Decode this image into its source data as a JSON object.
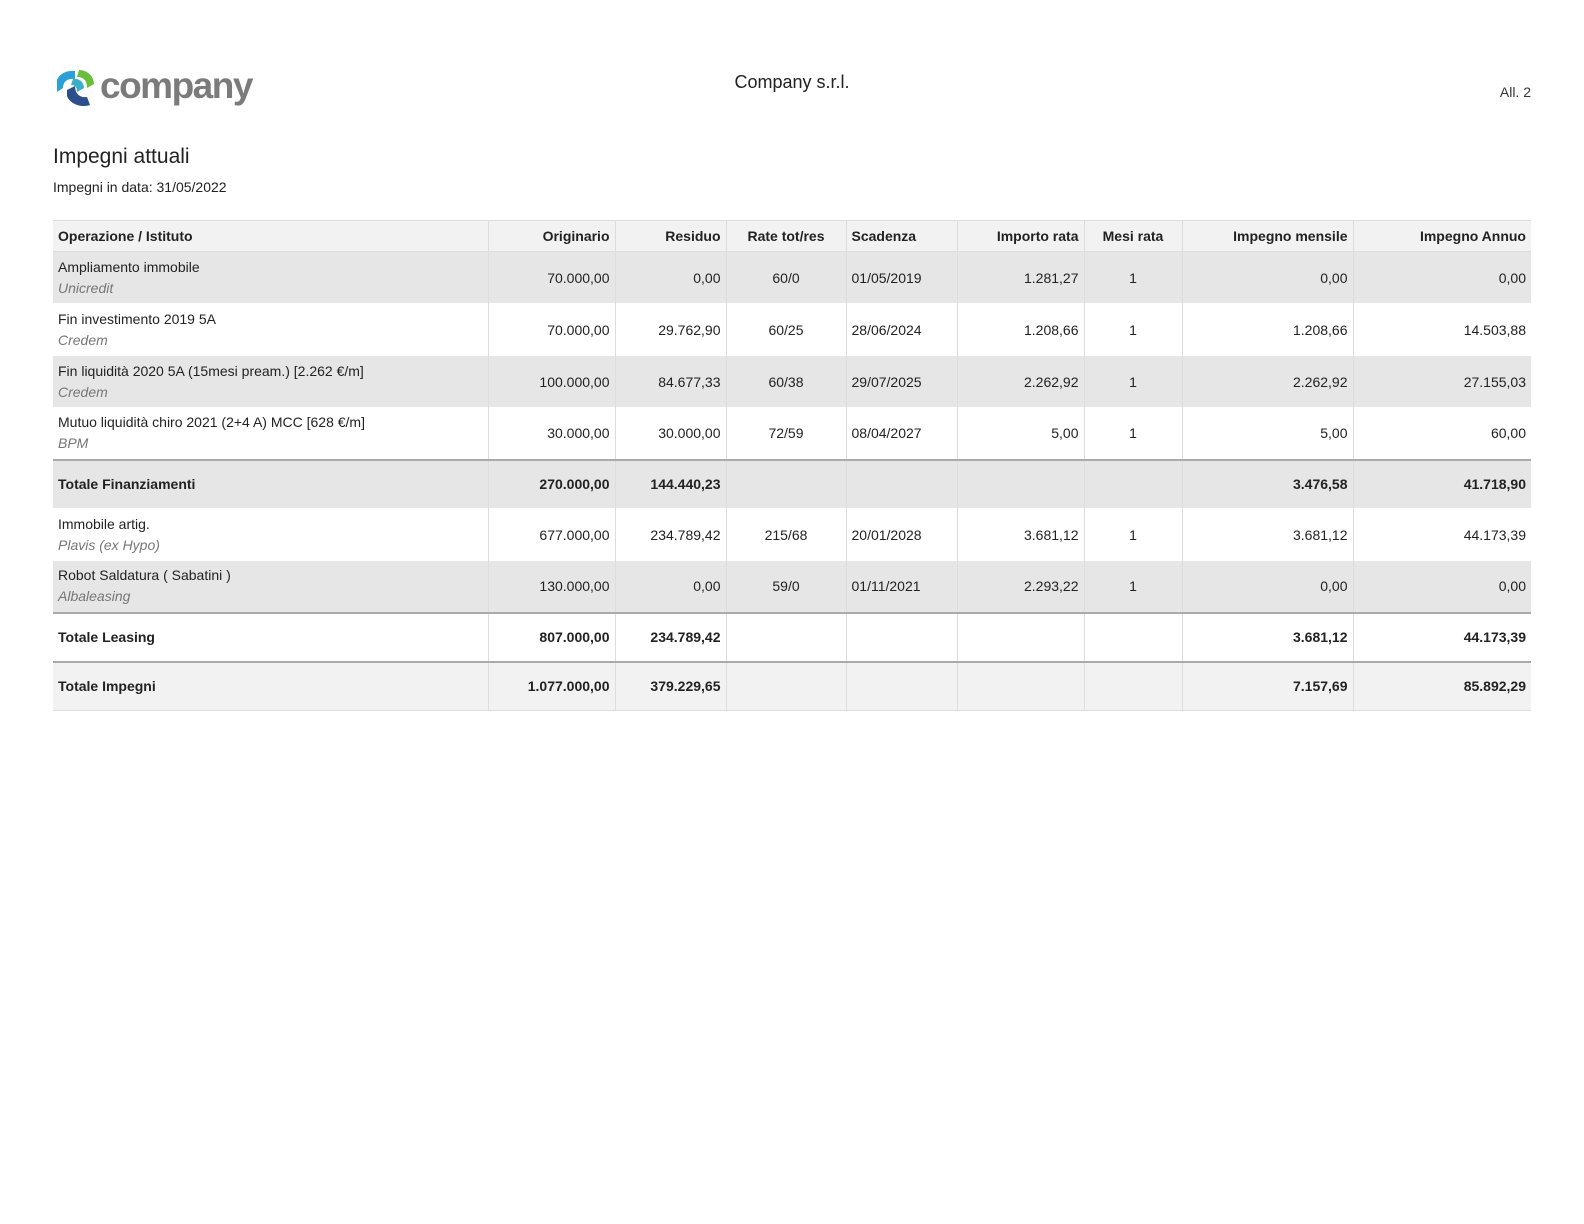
{
  "header": {
    "logo_text": "company",
    "company_name": "Company s.r.l.",
    "annex": "All. 2"
  },
  "title": "Impegni attuali",
  "subtitle": "Impegni in data: 31/05/2022",
  "columns": [
    "Operazione / Istituto",
    "Originario",
    "Residuo",
    "Rate tot/res",
    "Scadenza",
    "Importo rata",
    "Mesi rata",
    "Impegno mensile",
    "Impegno Annuo"
  ],
  "financing": [
    {
      "name": "Ampliamento immobile",
      "institute": "Unicredit",
      "originario": "70.000,00",
      "residuo": "0,00",
      "rate": "60/0",
      "scadenza": "01/05/2019",
      "importo_rata": "1.281,27",
      "mesi": "1",
      "mensile": "0,00",
      "annuo": "0,00"
    },
    {
      "name": "Fin investimento 2019 5A",
      "institute": "Credem",
      "originario": "70.000,00",
      "residuo": "29.762,90",
      "rate": "60/25",
      "scadenza": "28/06/2024",
      "importo_rata": "1.208,66",
      "mesi": "1",
      "mensile": "1.208,66",
      "annuo": "14.503,88"
    },
    {
      "name": "Fin liquidità 2020 5A (15mesi pream.) [2.262 €/m]",
      "institute": "Credem",
      "originario": "100.000,00",
      "residuo": "84.677,33",
      "rate": "60/38",
      "scadenza": "29/07/2025",
      "importo_rata": "2.262,92",
      "mesi": "1",
      "mensile": "2.262,92",
      "annuo": "27.155,03"
    },
    {
      "name": "Mutuo liquidità chiro 2021 (2+4 A) MCC [628 €/m]",
      "institute": "BPM",
      "originario": "30.000,00",
      "residuo": "30.000,00",
      "rate": "72/59",
      "scadenza": "08/04/2027",
      "importo_rata": "5,00",
      "mesi": "1",
      "mensile": "5,00",
      "annuo": "60,00"
    }
  ],
  "total_financing": {
    "label": "Totale Finanziamenti",
    "originario": "270.000,00",
    "residuo": "144.440,23",
    "mensile": "3.476,58",
    "annuo": "41.718,90"
  },
  "leasing": [
    {
      "name": "Immobile artig.",
      "institute": "Plavis (ex Hypo)",
      "originario": "677.000,00",
      "residuo": "234.789,42",
      "rate": "215/68",
      "scadenza": "20/01/2028",
      "importo_rata": "3.681,12",
      "mesi": "1",
      "mensile": "3.681,12",
      "annuo": "44.173,39"
    },
    {
      "name": "Robot Saldatura ( Sabatini )",
      "institute": "Albaleasing",
      "originario": "130.000,00",
      "residuo": "0,00",
      "rate": "59/0",
      "scadenza": "01/11/2021",
      "importo_rata": "2.293,22",
      "mesi": "1",
      "mensile": "0,00",
      "annuo": "0,00"
    }
  ],
  "total_leasing": {
    "label": "Totale Leasing",
    "originario": "807.000,00",
    "residuo": "234.789,42",
    "mensile": "3.681,12",
    "annuo": "44.173,39"
  },
  "total_all": {
    "label": "Totale Impegni",
    "originario": "1.077.000,00",
    "residuo": "379.229,65",
    "mensile": "7.157,69",
    "annuo": "85.892,29"
  },
  "colors": {
    "logo_green": "#6abf3a",
    "logo_blue": "#2a9fd8",
    "logo_navy": "#2b4e8c",
    "text_gray": "#7b7b7b"
  }
}
